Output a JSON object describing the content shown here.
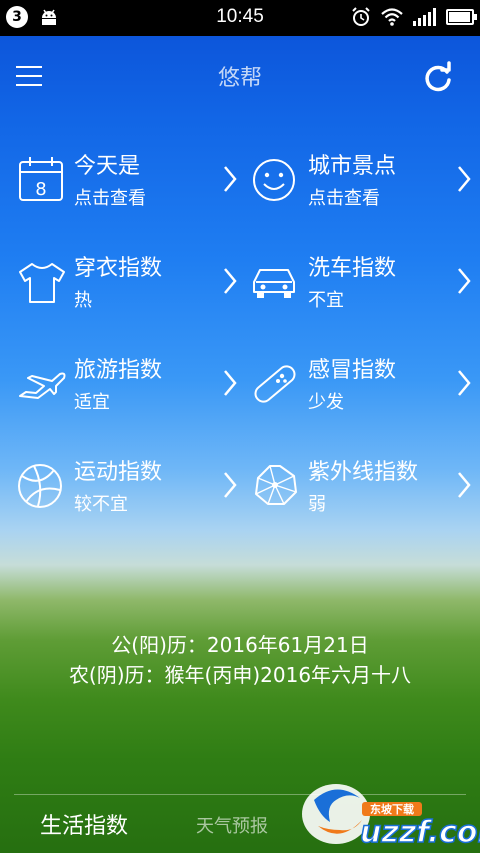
{
  "status": {
    "notification_count": "3",
    "time": "10:45"
  },
  "header": {
    "title": "悠帮"
  },
  "items": [
    {
      "name": "今天是",
      "value": "点击查看",
      "icon": "calendar-icon"
    },
    {
      "name": "城市景点",
      "value": "点击查看",
      "icon": "smiley-icon"
    },
    {
      "name": "穿衣指数",
      "value": "热",
      "icon": "tshirt-icon"
    },
    {
      "name": "洗车指数",
      "value": "不宜",
      "icon": "car-icon"
    },
    {
      "name": "旅游指数",
      "value": "适宜",
      "icon": "airplane-icon"
    },
    {
      "name": "感冒指数",
      "value": "少发",
      "icon": "pill-icon"
    },
    {
      "name": "运动指数",
      "value": "较不宜",
      "icon": "basketball-icon"
    },
    {
      "name": "紫外线指数",
      "value": "弱",
      "icon": "umbrella-sun-icon"
    }
  ],
  "dates": {
    "solar": "公(阳)历：2016年61月21日",
    "lunar": "农(阴)历：猴年(丙申)2016年六月十八"
  },
  "tabs": {
    "life": "生活指数",
    "weather": "天气预报"
  },
  "watermark": {
    "site": "uzzf.com",
    "tag": "东坡下载"
  },
  "colors": {
    "accent": "#ffffff",
    "sky_top": "#0a4fd6",
    "grass": "#2f7d14",
    "watermark_blue": "#1a6fd8",
    "watermark_orange": "#f07a1a"
  }
}
